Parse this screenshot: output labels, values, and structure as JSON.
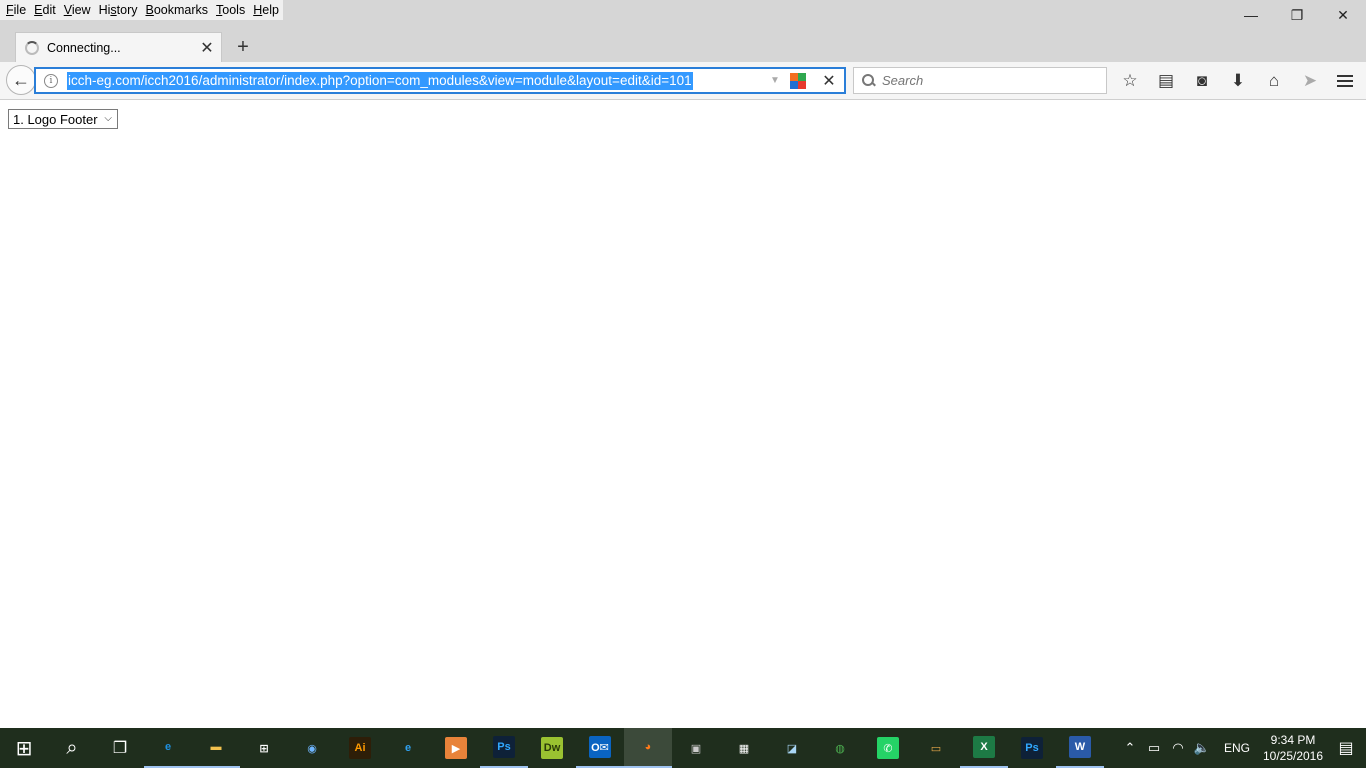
{
  "menubar": {
    "items": [
      {
        "label": "File",
        "accel": "F",
        "rest": "ile"
      },
      {
        "label": "Edit",
        "accel": "E",
        "rest": "dit"
      },
      {
        "label": "View",
        "accel": "V",
        "rest": "iew"
      },
      {
        "label": "History",
        "pre": "Hi",
        "accel": "s",
        "rest": "tory"
      },
      {
        "label": "Bookmarks",
        "accel": "B",
        "rest": "ookmarks"
      },
      {
        "label": "Tools",
        "accel": "T",
        "rest": "ools"
      },
      {
        "label": "Help",
        "accel": "H",
        "rest": "elp"
      }
    ]
  },
  "window_controls": {
    "minimize": "—",
    "restore": "❐",
    "close": "✕"
  },
  "tab": {
    "title": "Connecting...",
    "close": "✕"
  },
  "newtab": {
    "label": "+"
  },
  "navbar": {
    "back": "←",
    "url": "icch-eg.com/icch2016/administrator/index.php?option=com_modules&view=module&layout=edit&id=101",
    "info": "i",
    "stop": "✕",
    "search_placeholder": "Search"
  },
  "toolbar": {
    "icons": [
      {
        "name": "bookmark-star-icon",
        "glyph": "☆"
      },
      {
        "name": "reading-list-icon",
        "glyph": "▤"
      },
      {
        "name": "pocket-icon",
        "glyph": "◙"
      },
      {
        "name": "downloads-icon",
        "glyph": "⬇"
      },
      {
        "name": "home-icon",
        "glyph": "⌂"
      },
      {
        "name": "send-icon",
        "glyph": "➤"
      }
    ]
  },
  "content": {
    "select_value": "1. Logo Footer",
    "select_caret": "⌵"
  },
  "taskbar": {
    "start": "⊞",
    "search": "⌕",
    "task_view": "❐",
    "apps": [
      {
        "name": "edge-icon",
        "label": "e",
        "color": "#1e90e0",
        "bg": "transparent"
      },
      {
        "name": "file-explorer-icon",
        "label": "▬",
        "color": "#f2c14e",
        "bg": "transparent"
      },
      {
        "name": "store-icon",
        "label": "⊞",
        "color": "#ffffff",
        "bg": "transparent"
      },
      {
        "name": "media-app-icon",
        "label": "◉",
        "color": "#6fb6ff",
        "bg": "transparent"
      },
      {
        "name": "illustrator-icon",
        "label": "Ai",
        "color": "#ff9a00",
        "bg": "#2e1e08"
      },
      {
        "name": "internet-explorer-icon",
        "label": "e",
        "color": "#2fa0ee",
        "bg": "transparent"
      },
      {
        "name": "media-player-icon",
        "label": "▶",
        "color": "#ffffff",
        "bg": "#e8833a"
      },
      {
        "name": "photoshop-icon",
        "label": "Ps",
        "color": "#30a8ff",
        "bg": "#0e2138"
      },
      {
        "name": "dreamweaver-icon",
        "label": "Dw",
        "color": "#2a3b08",
        "bg": "#9ac231"
      },
      {
        "name": "outlook-icon",
        "label": "O✉",
        "color": "#ffffff",
        "bg": "#0a64c2"
      },
      {
        "name": "firefox-icon",
        "label": "◕",
        "color": "#ff7a1a",
        "bg": "transparent"
      },
      {
        "name": "lock-app-icon",
        "label": "▣",
        "color": "#cccccc",
        "bg": "transparent"
      },
      {
        "name": "calculator-icon",
        "label": "▦",
        "color": "#ffffff",
        "bg": "transparent"
      },
      {
        "name": "notes-icon",
        "label": "◪",
        "color": "#a9d6f5",
        "bg": "transparent"
      },
      {
        "name": "chrome-icon",
        "label": "◍",
        "color": "#4caf50",
        "bg": "transparent"
      },
      {
        "name": "whatsapp-icon",
        "label": "✆",
        "color": "#ffffff",
        "bg": "#25d366"
      },
      {
        "name": "remote-desktop-icon",
        "label": "▭",
        "color": "#e8a84a",
        "bg": "transparent"
      },
      {
        "name": "excel-icon",
        "label": "X",
        "color": "#ffffff",
        "bg": "#1d7a45"
      },
      {
        "name": "photoshop-2-icon",
        "label": "Ps",
        "color": "#30a8ff",
        "bg": "#0e2138"
      },
      {
        "name": "word-icon",
        "label": "W",
        "color": "#ffffff",
        "bg": "#2a5aa8"
      }
    ],
    "tray": {
      "chevron": "⌃",
      "battery": "▭",
      "wifi": "◠",
      "volume": "🔈",
      "lang": "ENG",
      "time": "9:34 PM",
      "date": "10/25/2016",
      "notifications": "▤"
    }
  }
}
